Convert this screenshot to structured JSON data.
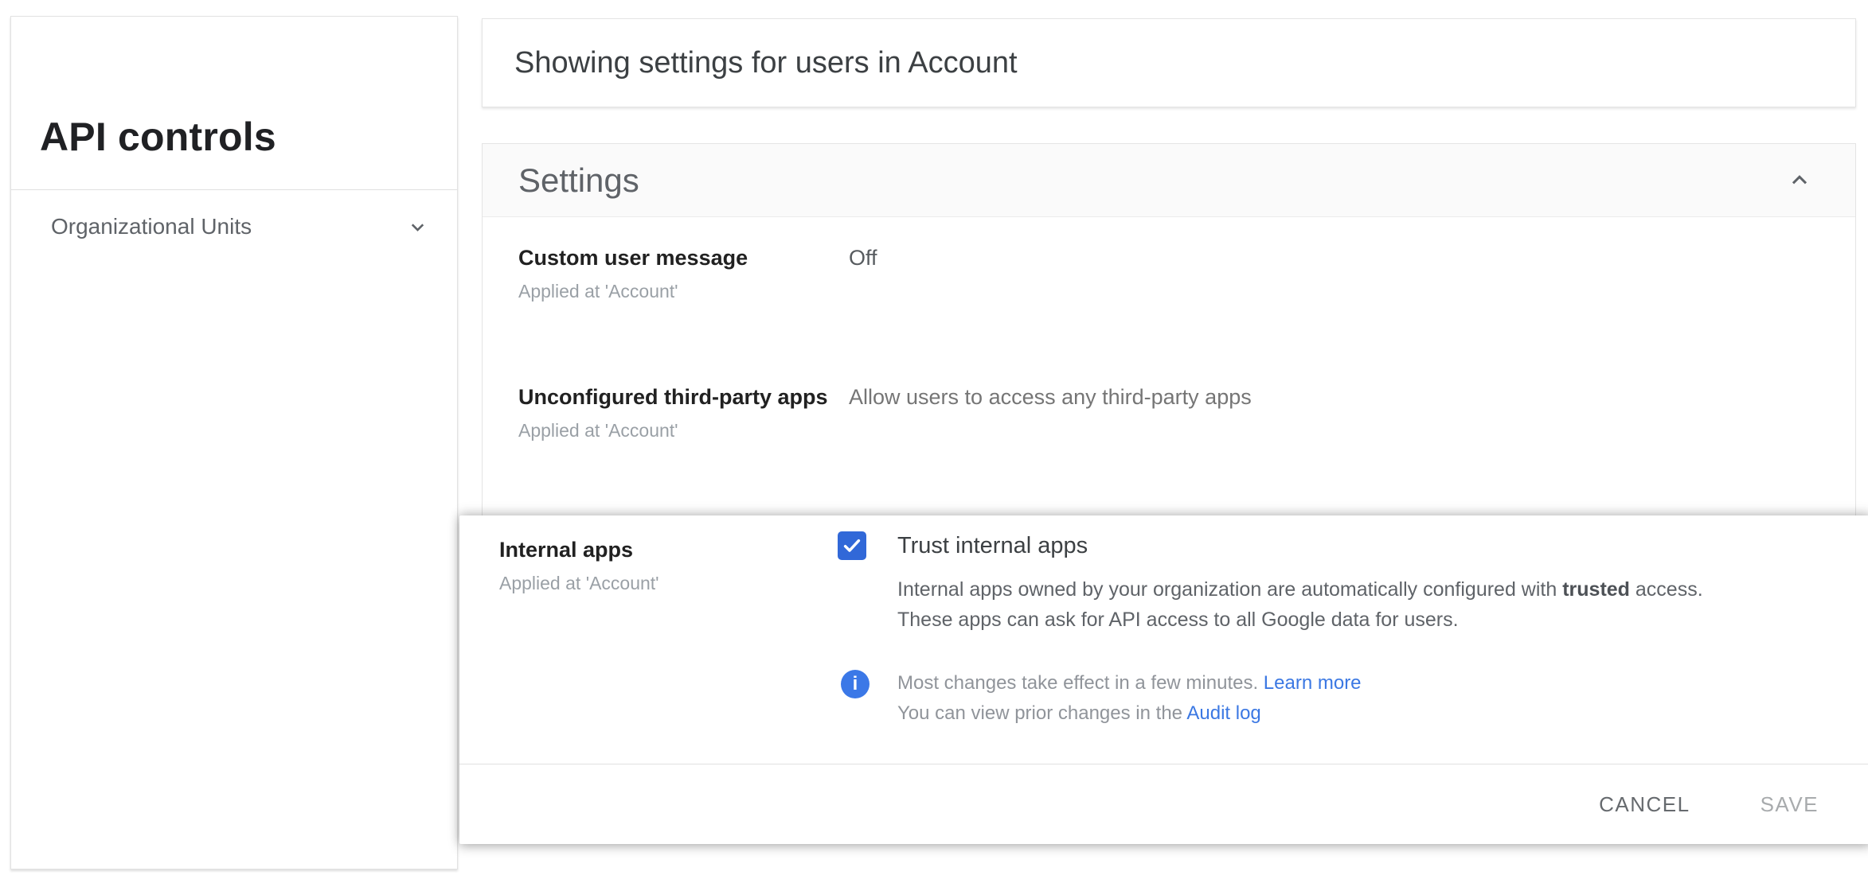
{
  "sidebar": {
    "title": "API controls",
    "items": [
      {
        "label": "Organizational Units"
      }
    ]
  },
  "scope_banner": {
    "text": "Showing settings for users in Account"
  },
  "settings_card": {
    "title": "Settings",
    "rows": [
      {
        "label": "Custom user message",
        "applied_at": "Applied at 'Account'",
        "value": "Off"
      },
      {
        "label": "Unconfigured third-party apps",
        "applied_at": "Applied at 'Account'",
        "value": "Allow users to access any third-party apps"
      }
    ]
  },
  "dialog": {
    "row_label": "Internal apps",
    "applied_at": "Applied at 'Account'",
    "checkbox": {
      "checked": true,
      "label": "Trust internal apps"
    },
    "description": {
      "before_bold": "Internal apps owned by your organization are automatically configured with ",
      "bold": "trusted",
      "after_bold": " access. These apps can ask for API access to all Google data for users."
    },
    "info": {
      "line1_text": "Most changes take effect in a few minutes. ",
      "line1_link": "Learn more",
      "line2_text": "You can view prior changes in the ",
      "line2_link": "Audit log",
      "icon_glyph": "i"
    },
    "buttons": {
      "cancel": "CANCEL",
      "save": "SAVE"
    }
  },
  "icons": {
    "ou_expander": "chevron-down-icon",
    "settings_collapse": "chevron-up-icon",
    "info": "info-icon",
    "checkbox_check": "check-icon"
  },
  "colors": {
    "checkbox_blue": "#3168d8",
    "info_icon_blue": "#3b78e7",
    "link_blue": "#3b78e3",
    "header_bg": "#fafafa",
    "border_gray": "#e0e0e0",
    "text_dark": "#212121",
    "text_gray": "#5f6368",
    "text_light_gray": "#9aa0a6"
  }
}
